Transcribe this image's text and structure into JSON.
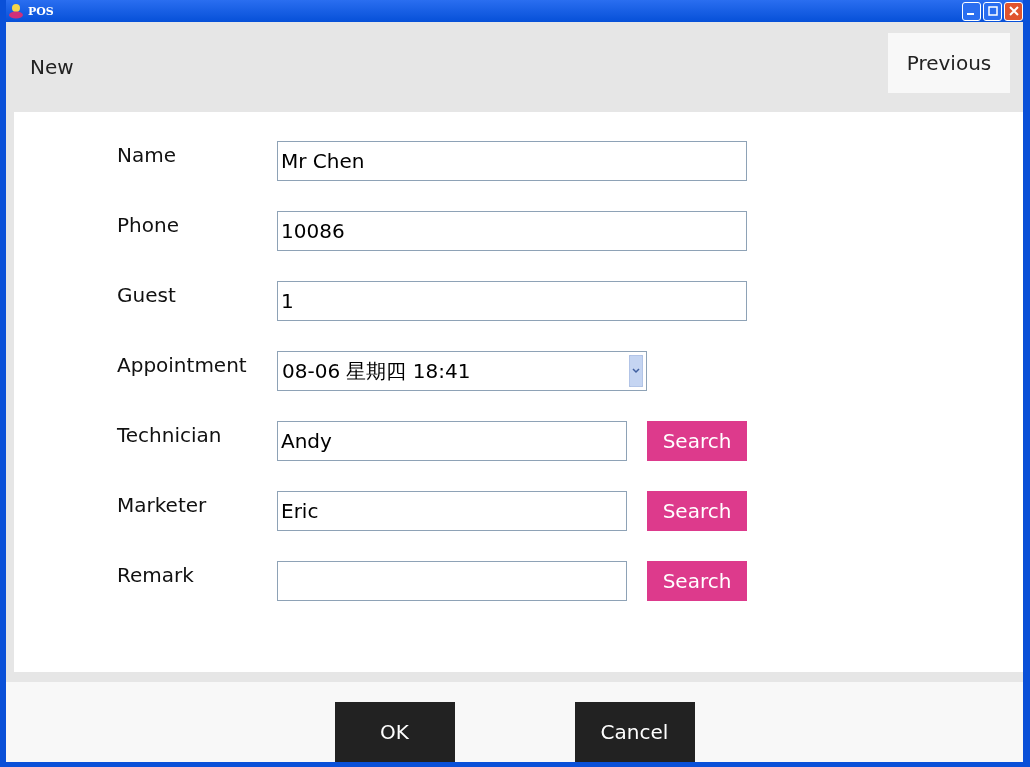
{
  "window": {
    "title": "POS"
  },
  "header": {
    "left": "New",
    "right_button": "Previous"
  },
  "fields": [
    {
      "label": "Name",
      "kind": "text",
      "value": "Mr Chen"
    },
    {
      "label": "Phone",
      "kind": "text",
      "value": "10086"
    },
    {
      "label": "Guest",
      "kind": "text",
      "value": "1"
    },
    {
      "label": "Appointment",
      "kind": "select",
      "value": "08-06 星期四 18:41"
    },
    {
      "label": "Technician",
      "kind": "search",
      "value": "Andy",
      "button": "Search"
    },
    {
      "label": "Marketer",
      "kind": "search",
      "value": "Eric",
      "button": "Search"
    },
    {
      "label": "Remark",
      "kind": "search",
      "button": "Search"
    }
  ],
  "buttons": [
    "OK",
    "Cancel"
  ]
}
